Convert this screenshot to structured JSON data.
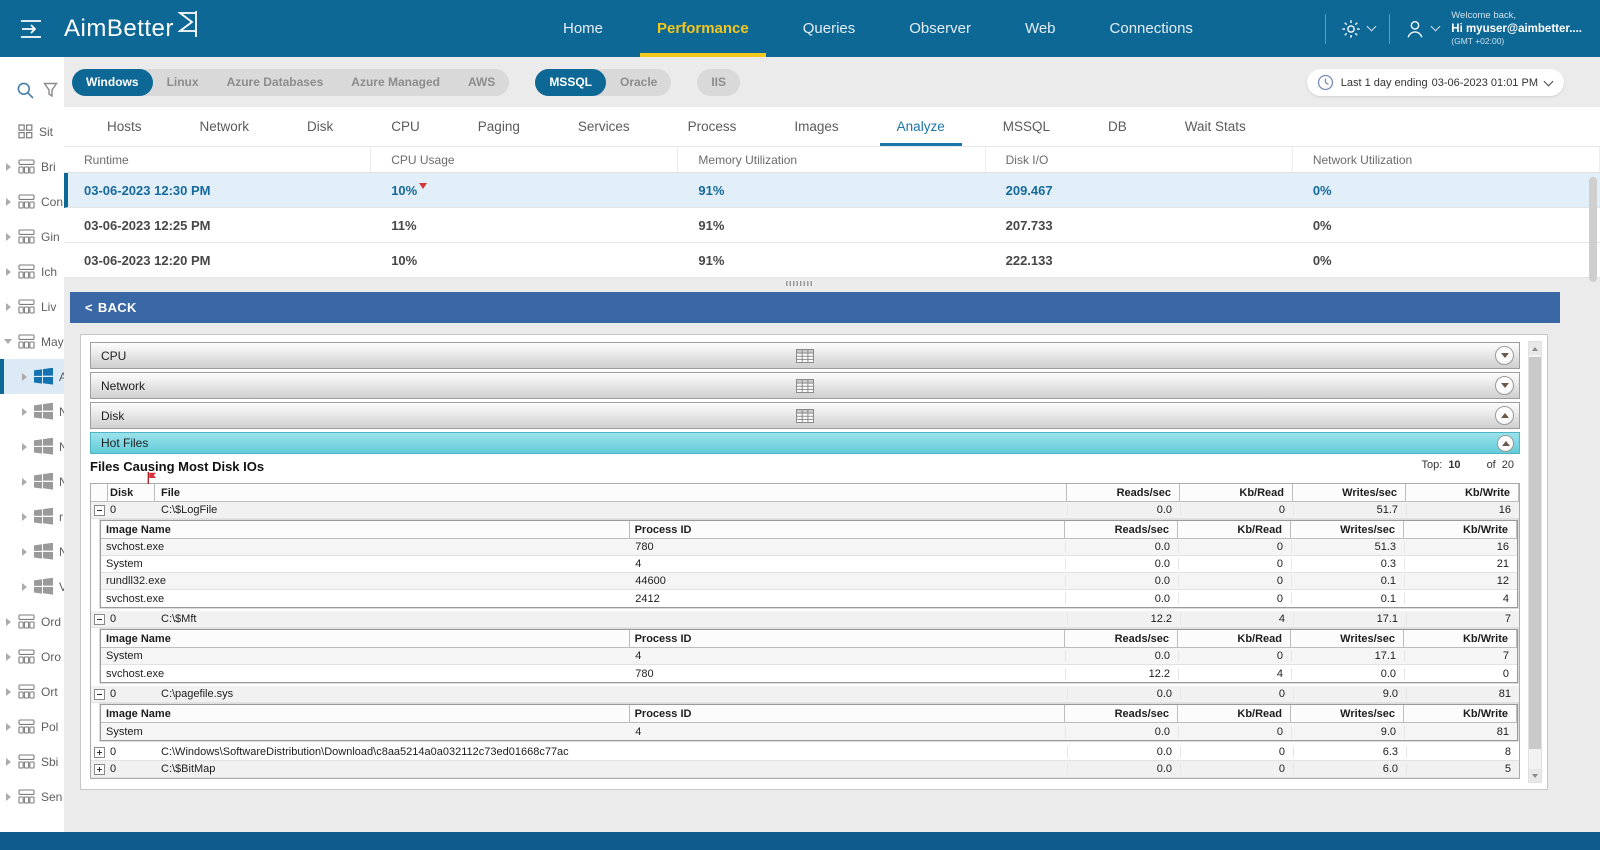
{
  "header": {
    "brand": "AimBetter",
    "nav": [
      {
        "label": "Home",
        "active": false
      },
      {
        "label": "Performance",
        "active": true
      },
      {
        "label": "Queries",
        "active": false
      },
      {
        "label": "Observer",
        "active": false
      },
      {
        "label": "Web",
        "active": false
      },
      {
        "label": "Connections",
        "active": false
      }
    ],
    "welcome_line1": "Welcome back,",
    "welcome_line2": "Hi myuser@aimbetter....",
    "welcome_line3": "(GMT +02:00)"
  },
  "sidebar": {
    "items": [
      {
        "label": "Sit",
        "type": "group-grid",
        "caret": "none",
        "selected": false
      },
      {
        "label": "Bri",
        "type": "group",
        "caret": "right",
        "selected": false
      },
      {
        "label": "Con",
        "type": "group",
        "caret": "right",
        "selected": false
      },
      {
        "label": "Gin",
        "type": "group",
        "caret": "right",
        "selected": false
      },
      {
        "label": "Ich",
        "type": "group",
        "caret": "right",
        "selected": false
      },
      {
        "label": "Liv",
        "type": "group",
        "caret": "right",
        "selected": false
      },
      {
        "label": "May",
        "type": "group",
        "caret": "down",
        "selected": false
      },
      {
        "label": "A",
        "type": "host",
        "caret": "right",
        "selected": true
      },
      {
        "label": "N",
        "type": "host",
        "caret": "right",
        "selected": false
      },
      {
        "label": "N",
        "type": "host",
        "caret": "right",
        "selected": false
      },
      {
        "label": "N",
        "type": "host",
        "caret": "right",
        "selected": false
      },
      {
        "label": "r",
        "type": "host",
        "caret": "right",
        "selected": false
      },
      {
        "label": "N",
        "type": "host",
        "caret": "right",
        "selected": false
      },
      {
        "label": "V",
        "type": "host",
        "caret": "right",
        "selected": false
      },
      {
        "label": "Ord",
        "type": "group",
        "caret": "right",
        "selected": false
      },
      {
        "label": "Oro",
        "type": "group",
        "caret": "right",
        "selected": false
      },
      {
        "label": "Ort",
        "type": "group",
        "caret": "right",
        "selected": false
      },
      {
        "label": "Pol",
        "type": "group",
        "caret": "right",
        "selected": false
      },
      {
        "label": "Sbi",
        "type": "group",
        "caret": "right",
        "selected": false
      },
      {
        "label": "Sen",
        "type": "group",
        "caret": "right",
        "selected": false
      }
    ]
  },
  "filters": {
    "os_group": [
      {
        "label": "Windows",
        "active": true
      },
      {
        "label": "Linux",
        "active": false
      },
      {
        "label": "Azure Databases",
        "active": false
      },
      {
        "label": "Azure Managed",
        "active": false
      },
      {
        "label": "AWS",
        "active": false
      }
    ],
    "db_group": [
      {
        "label": "MSSQL",
        "active": true
      },
      {
        "label": "Oracle",
        "active": false
      }
    ],
    "web_group": [
      {
        "label": "IIS",
        "active": false
      }
    ],
    "time_label": "Last 1 day ending",
    "time_value": "03-06-2023 01:01 PM"
  },
  "tabs": {
    "items": [
      "Hosts",
      "Network",
      "Disk",
      "CPU",
      "Paging",
      "Services",
      "Process",
      "Images",
      "Analyze",
      "MSSQL",
      "DB",
      "Wait Stats"
    ],
    "active": "Analyze"
  },
  "runtime_table": {
    "columns": [
      "Runtime",
      "CPU Usage",
      "Memory Utilization",
      "Disk I/O",
      "Network Utilization"
    ],
    "rows": [
      {
        "runtime": "03-06-2023 12:30 PM",
        "cpu": "10%",
        "memory": "91%",
        "disk": "209.467",
        "network": "0%",
        "selected": true,
        "alert": true
      },
      {
        "runtime": "03-06-2023 12:25 PM",
        "cpu": "11%",
        "memory": "91%",
        "disk": "207.733",
        "network": "0%",
        "selected": false,
        "alert": false
      },
      {
        "runtime": "03-06-2023 12:20 PM",
        "cpu": "10%",
        "memory": "91%",
        "disk": "222.133",
        "network": "0%",
        "selected": false,
        "alert": false
      }
    ]
  },
  "back": {
    "chevron": "<",
    "label": "BACK"
  },
  "accordion": [
    {
      "label": "CPU",
      "expanded": false,
      "accent": false
    },
    {
      "label": "Network",
      "expanded": false,
      "accent": false
    },
    {
      "label": "Disk",
      "expanded": true,
      "accent": false
    },
    {
      "label": "Hot Files",
      "expanded": true,
      "accent": true
    }
  ],
  "hot_files": {
    "title": "Files Causing Most Disk IOs",
    "top_label": "Top:",
    "top_value": "10",
    "of_label": "of",
    "of_value": "20",
    "columns": [
      "Disk",
      "File",
      "Reads/sec",
      "Kb/Read",
      "Writes/sec",
      "Kb/Write"
    ],
    "sub_columns": [
      "Image Name",
      "Process ID",
      "Reads/sec",
      "Kb/Read",
      "Writes/sec",
      "Kb/Write"
    ],
    "groups": [
      {
        "disk": "0",
        "file": "C:\\$LogFile",
        "reads": "0.0",
        "kb_read": "0",
        "writes": "51.7",
        "kb_write": "16",
        "expanded": true,
        "children": [
          {
            "image": "svchost.exe",
            "pid": "780",
            "reads": "0.0",
            "kb_read": "0",
            "writes": "51.3",
            "kb_write": "16"
          },
          {
            "image": "System",
            "pid": "4",
            "reads": "0.0",
            "kb_read": "0",
            "writes": "0.3",
            "kb_write": "21"
          },
          {
            "image": "rundll32.exe",
            "pid": "44600",
            "reads": "0.0",
            "kb_read": "0",
            "writes": "0.1",
            "kb_write": "12"
          },
          {
            "image": "svchost.exe",
            "pid": "2412",
            "reads": "0.0",
            "kb_read": "0",
            "writes": "0.1",
            "kb_write": "4"
          }
        ]
      },
      {
        "disk": "0",
        "file": "C:\\$Mft",
        "reads": "12.2",
        "kb_read": "4",
        "writes": "17.1",
        "kb_write": "7",
        "expanded": true,
        "children": [
          {
            "image": "System",
            "pid": "4",
            "reads": "0.0",
            "kb_read": "0",
            "writes": "17.1",
            "kb_write": "7"
          },
          {
            "image": "svchost.exe",
            "pid": "780",
            "reads": "12.2",
            "kb_read": "4",
            "writes": "0.0",
            "kb_write": "0"
          }
        ]
      },
      {
        "disk": "0",
        "file": "C:\\pagefile.sys",
        "reads": "0.0",
        "kb_read": "0",
        "writes": "9.0",
        "kb_write": "81",
        "expanded": true,
        "children": [
          {
            "image": "System",
            "pid": "4",
            "reads": "0.0",
            "kb_read": "0",
            "writes": "9.0",
            "kb_write": "81"
          }
        ]
      },
      {
        "disk": "0",
        "file": "C:\\Windows\\SoftwareDistribution\\Download\\c8aa5214a0a032112c73ed01668c77ac",
        "reads": "0.0",
        "kb_read": "0",
        "writes": "6.3",
        "kb_write": "8",
        "expanded": false,
        "children": []
      },
      {
        "disk": "0",
        "file": "C:\\$BitMap",
        "reads": "0.0",
        "kb_read": "0",
        "writes": "6.0",
        "kb_write": "5",
        "expanded": false,
        "children": []
      }
    ]
  },
  "colors": {
    "header_blue": "#0D6896",
    "accent_yellow": "#F3C71B",
    "back_bar_blue": "#3A67A5",
    "hot_files_cyan": "#6FD4E1",
    "selected_row_bg": "#E2EFF8",
    "footer_blue": "#0D5C8C"
  }
}
